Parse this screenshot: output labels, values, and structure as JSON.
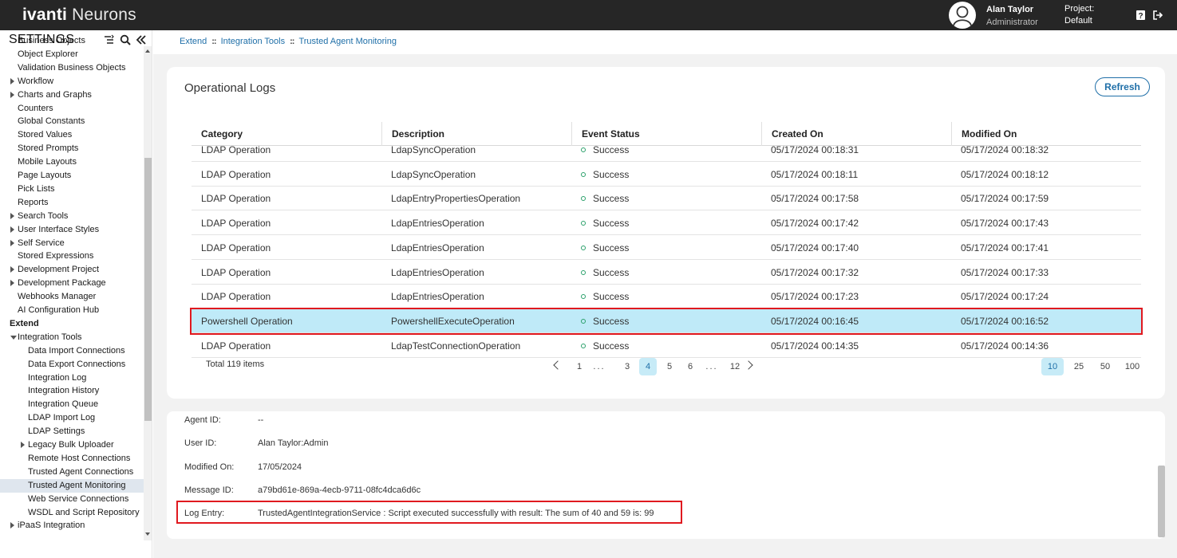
{
  "app": {
    "brand_bold": "ivanti",
    "brand_rest": " Neurons",
    "user_name": "Alan Taylor",
    "user_role": "Administrator",
    "project_label": "Project:",
    "project_value": "Default"
  },
  "sidebar": {
    "title": "SETTINGS",
    "items": [
      {
        "label": "Business Objects",
        "indent": 1,
        "arrow": "none"
      },
      {
        "label": "Object Explorer",
        "indent": 1,
        "arrow": "none"
      },
      {
        "label": "Validation Business Objects",
        "indent": 1,
        "arrow": "none"
      },
      {
        "label": "Workflow",
        "indent": 1,
        "arrow": "right"
      },
      {
        "label": "Charts and Graphs",
        "indent": 1,
        "arrow": "right"
      },
      {
        "label": "Counters",
        "indent": 1,
        "arrow": "none"
      },
      {
        "label": "Global Constants",
        "indent": 1,
        "arrow": "none"
      },
      {
        "label": "Stored Values",
        "indent": 1,
        "arrow": "none"
      },
      {
        "label": "Stored Prompts",
        "indent": 1,
        "arrow": "none"
      },
      {
        "label": "Mobile Layouts",
        "indent": 1,
        "arrow": "none"
      },
      {
        "label": "Page Layouts",
        "indent": 1,
        "arrow": "none"
      },
      {
        "label": "Pick Lists",
        "indent": 1,
        "arrow": "none"
      },
      {
        "label": "Reports",
        "indent": 1,
        "arrow": "none"
      },
      {
        "label": "Search Tools",
        "indent": 1,
        "arrow": "right"
      },
      {
        "label": "User Interface Styles",
        "indent": 1,
        "arrow": "right"
      },
      {
        "label": "Self Service",
        "indent": 1,
        "arrow": "right"
      },
      {
        "label": "Stored Expressions",
        "indent": 1,
        "arrow": "none"
      },
      {
        "label": "Development Project",
        "indent": 1,
        "arrow": "right"
      },
      {
        "label": "Development Package",
        "indent": 1,
        "arrow": "right"
      },
      {
        "label": "Webhooks Manager",
        "indent": 1,
        "arrow": "none"
      },
      {
        "label": "AI Configuration Hub",
        "indent": 1,
        "arrow": "none"
      },
      {
        "label": "Extend",
        "indent": 0,
        "arrow": "none",
        "section": true
      },
      {
        "label": "Integration Tools",
        "indent": 1,
        "arrow": "down"
      },
      {
        "label": "Data Import Connections",
        "indent": 2,
        "arrow": "none"
      },
      {
        "label": "Data Export Connections",
        "indent": 2,
        "arrow": "none"
      },
      {
        "label": "Integration Log",
        "indent": 2,
        "arrow": "none"
      },
      {
        "label": "Integration History",
        "indent": 2,
        "arrow": "none"
      },
      {
        "label": "Integration Queue",
        "indent": 2,
        "arrow": "none"
      },
      {
        "label": "LDAP Import Log",
        "indent": 2,
        "arrow": "none"
      },
      {
        "label": "LDAP Settings",
        "indent": 2,
        "arrow": "none"
      },
      {
        "label": "Legacy Bulk Uploader",
        "indent": 2,
        "arrow": "right"
      },
      {
        "label": "Remote Host Connections",
        "indent": 2,
        "arrow": "none"
      },
      {
        "label": "Trusted Agent Connections",
        "indent": 2,
        "arrow": "none"
      },
      {
        "label": "Trusted Agent Monitoring",
        "indent": 2,
        "arrow": "none",
        "selected": true
      },
      {
        "label": "Web Service Connections",
        "indent": 2,
        "arrow": "none"
      },
      {
        "label": "WSDL and Script Repository",
        "indent": 2,
        "arrow": "none"
      },
      {
        "label": "iPaaS Integration",
        "indent": 1,
        "arrow": "right"
      }
    ]
  },
  "breadcrumb": [
    "Extend",
    "Integration Tools",
    "Trusted Agent Monitoring"
  ],
  "logs": {
    "title": "Operational Logs",
    "refresh_label": "Refresh",
    "columns": [
      "Category",
      "Description",
      "Event Status",
      "Created On",
      "Modified On"
    ],
    "rows": [
      {
        "category": "LDAP Operation",
        "description": "LdapSyncOperation",
        "status": "Success",
        "created": "05/17/2024 00:18:31",
        "modified": "05/17/2024 00:18:32"
      },
      {
        "category": "LDAP Operation",
        "description": "LdapSyncOperation",
        "status": "Success",
        "created": "05/17/2024 00:18:11",
        "modified": "05/17/2024 00:18:12"
      },
      {
        "category": "LDAP Operation",
        "description": "LdapEntryPropertiesOperation",
        "status": "Success",
        "created": "05/17/2024 00:17:58",
        "modified": "05/17/2024 00:17:59"
      },
      {
        "category": "LDAP Operation",
        "description": "LdapEntriesOperation",
        "status": "Success",
        "created": "05/17/2024 00:17:42",
        "modified": "05/17/2024 00:17:43"
      },
      {
        "category": "LDAP Operation",
        "description": "LdapEntriesOperation",
        "status": "Success",
        "created": "05/17/2024 00:17:40",
        "modified": "05/17/2024 00:17:41"
      },
      {
        "category": "LDAP Operation",
        "description": "LdapEntriesOperation",
        "status": "Success",
        "created": "05/17/2024 00:17:32",
        "modified": "05/17/2024 00:17:33"
      },
      {
        "category": "LDAP Operation",
        "description": "LdapEntriesOperation",
        "status": "Success",
        "created": "05/17/2024 00:17:23",
        "modified": "05/17/2024 00:17:24"
      },
      {
        "category": "Powershell Operation",
        "description": "PowershellExecuteOperation",
        "status": "Success",
        "created": "05/17/2024 00:16:45",
        "modified": "05/17/2024 00:16:52",
        "selected": true
      },
      {
        "category": "LDAP Operation",
        "description": "LdapTestConnectionOperation",
        "status": "Success",
        "created": "05/17/2024 00:14:35",
        "modified": "05/17/2024 00:14:36"
      }
    ],
    "status_color": "#2aa06a",
    "total": "Total 119 items",
    "pages": [
      "1",
      "...",
      "3",
      "4",
      "5",
      "6",
      "...",
      "12"
    ],
    "current_page": "4",
    "page_sizes": [
      "10",
      "25",
      "50",
      "100"
    ],
    "current_page_size": "10"
  },
  "details": {
    "fields": [
      {
        "label": "Agent ID:",
        "value": "--"
      },
      {
        "label": "User ID:",
        "value": "Alan Taylor:Admin"
      },
      {
        "label": "Modified On:",
        "value": "17/05/2024"
      },
      {
        "label": "Message ID:",
        "value": "a79bd61e-869a-4ecb-9711-08fc4dca6d6c"
      },
      {
        "label": "Log Entry:",
        "value": "TrustedAgentIntegrationService : Script executed successfully with result: The sum of 40 and 59 is: 99"
      }
    ]
  },
  "colors": {
    "accent": "#1f6fa8",
    "highlight": "#e0191f",
    "selected_row": "#bfeaf8",
    "topbar": "#262626"
  }
}
